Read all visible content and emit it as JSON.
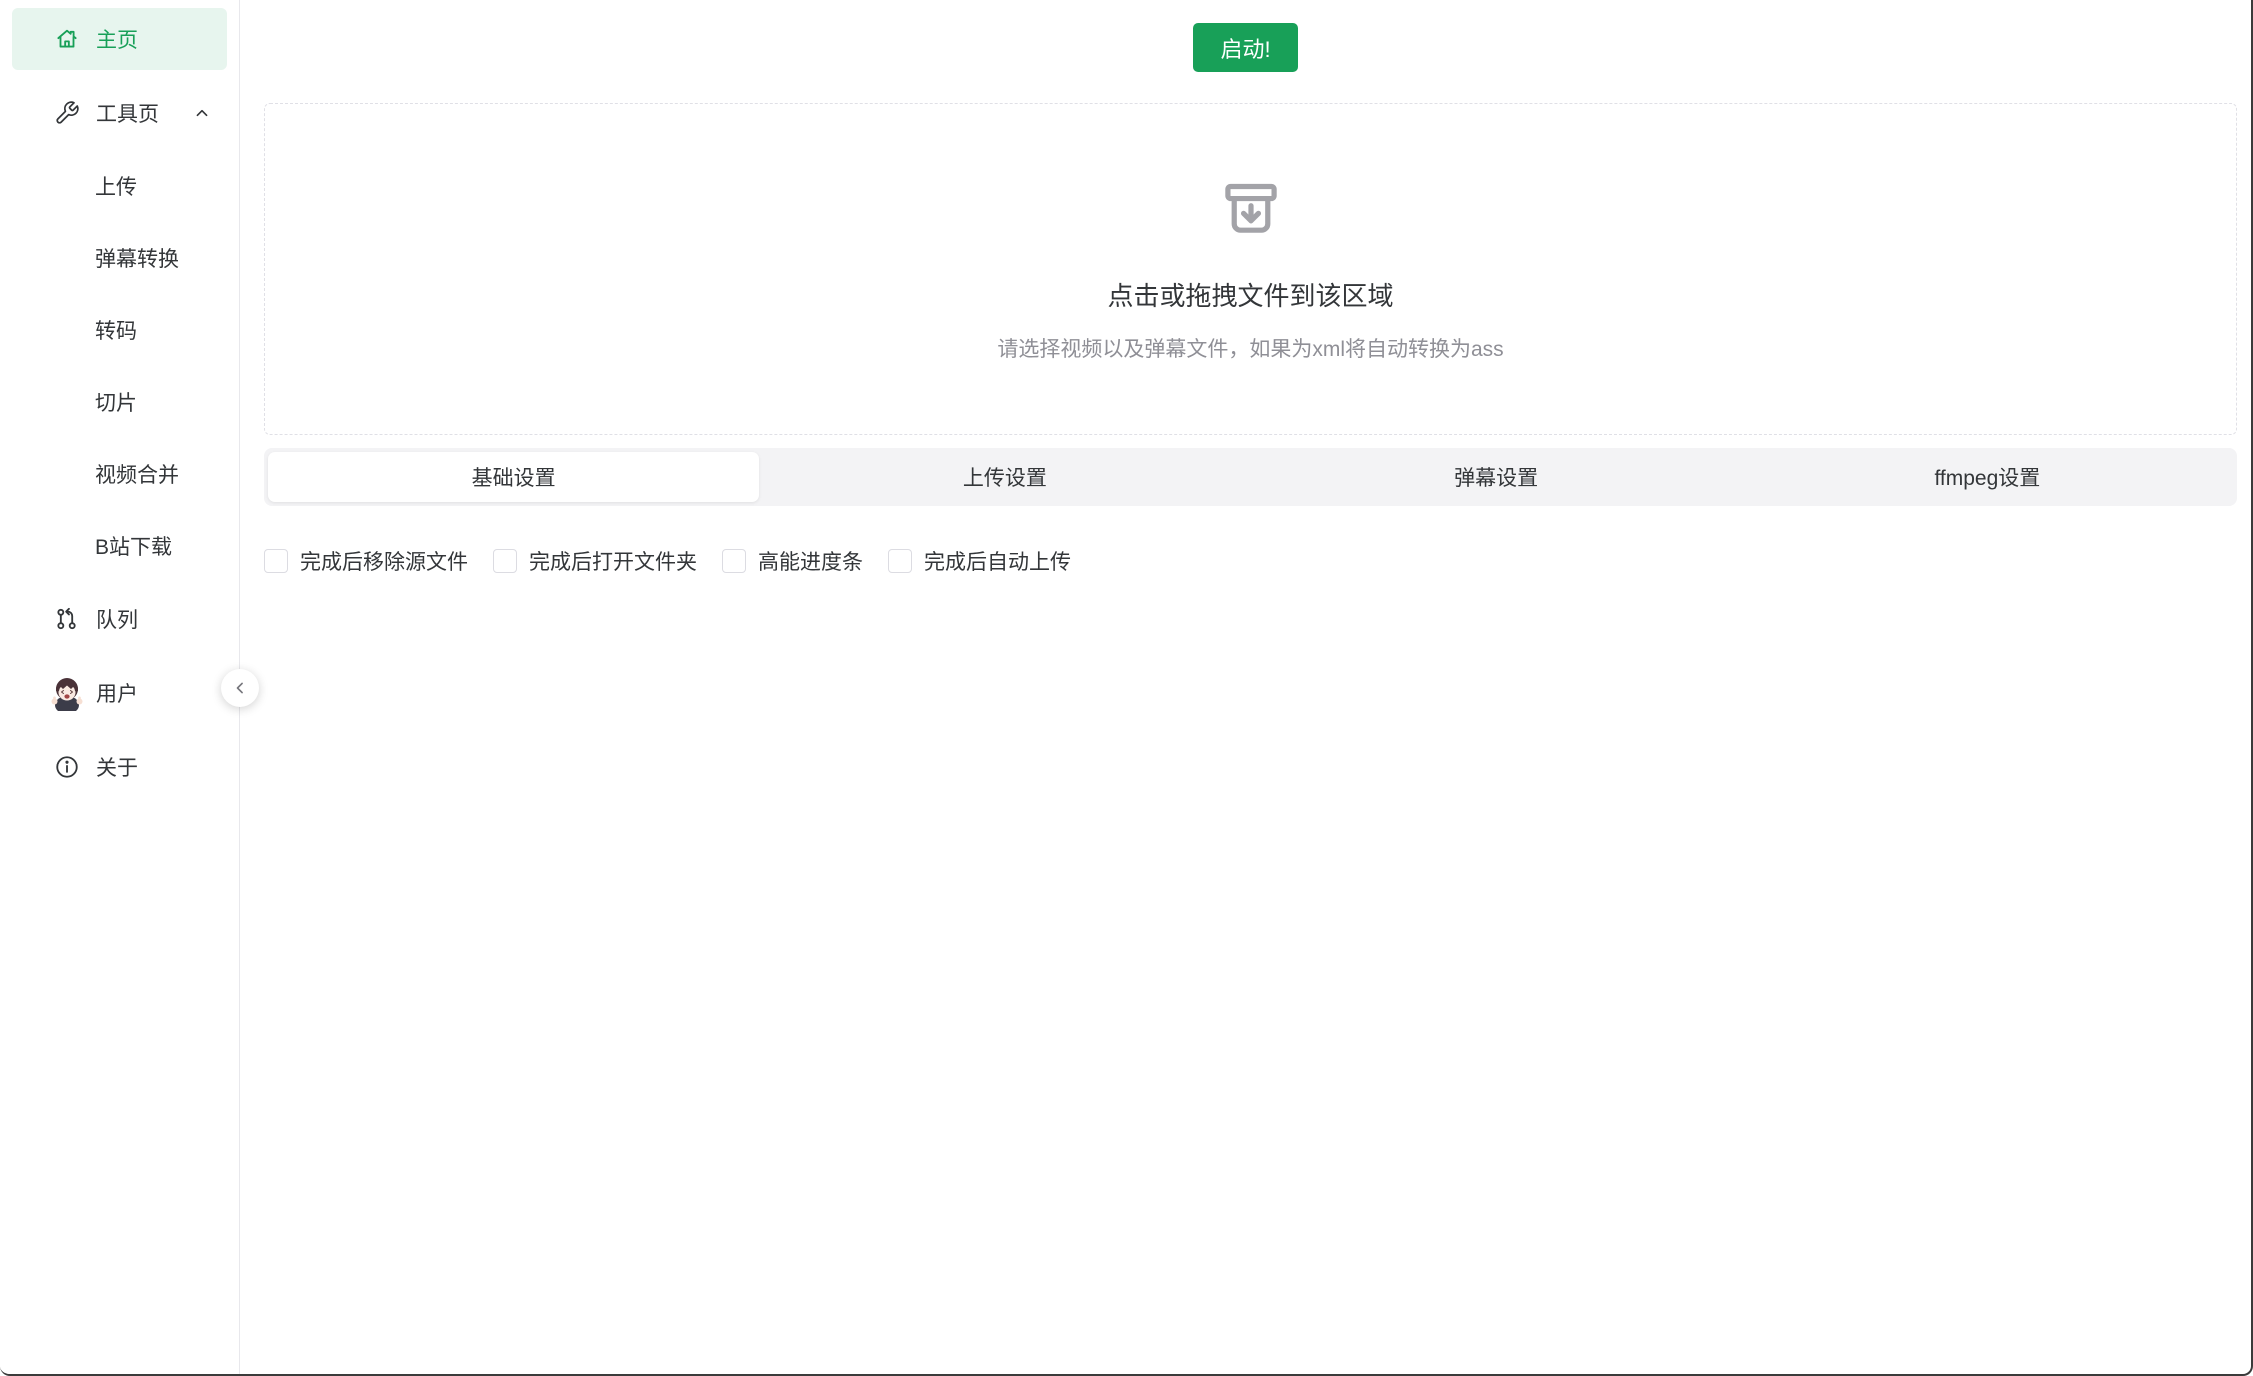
{
  "colors": {
    "primary_green": "#18a058",
    "active_menu_bg": "#e7f5ee",
    "text": "#333639",
    "muted_text": "#8f8f96",
    "dashed_border": "#e0e0e6",
    "tab_rail_bg": "#f3f3f5",
    "window_border": "#3b3b3b"
  },
  "sidebar": {
    "home": {
      "label": "主页",
      "icon": "home-icon",
      "active": true
    },
    "tools": {
      "label": "工具页",
      "icon": "wrench-icon",
      "expanded": true,
      "chevron_icon": "chevron-up-icon",
      "children": [
        {
          "label": "上传"
        },
        {
          "label": "弹幕转换"
        },
        {
          "label": "转码"
        },
        {
          "label": "切片"
        },
        {
          "label": "视频合并"
        },
        {
          "label": "B站下载"
        }
      ]
    },
    "queue": {
      "label": "队列",
      "icon": "queue-icon"
    },
    "user": {
      "label": "用户",
      "icon": "avatar"
    },
    "about": {
      "label": "关于",
      "icon": "info-icon"
    },
    "collapse_icon": "chevron-left-icon"
  },
  "main": {
    "start_button_label": "启动!",
    "dropzone": {
      "icon": "archive-download-icon",
      "title": "点击或拖拽文件到该区域",
      "subtitle": "请选择视频以及弹幕文件，如果为xml将自动转换为ass"
    },
    "tabs": [
      {
        "label": "基础设置",
        "active": true
      },
      {
        "label": "上传设置",
        "active": false
      },
      {
        "label": "弹幕设置",
        "active": false
      },
      {
        "label": "ffmpeg设置",
        "active": false
      }
    ],
    "checkboxes": [
      {
        "label": "完成后移除源文件",
        "checked": false
      },
      {
        "label": "完成后打开文件夹",
        "checked": false
      },
      {
        "label": "高能进度条",
        "checked": false
      },
      {
        "label": "完成后自动上传",
        "checked": false
      }
    ]
  }
}
